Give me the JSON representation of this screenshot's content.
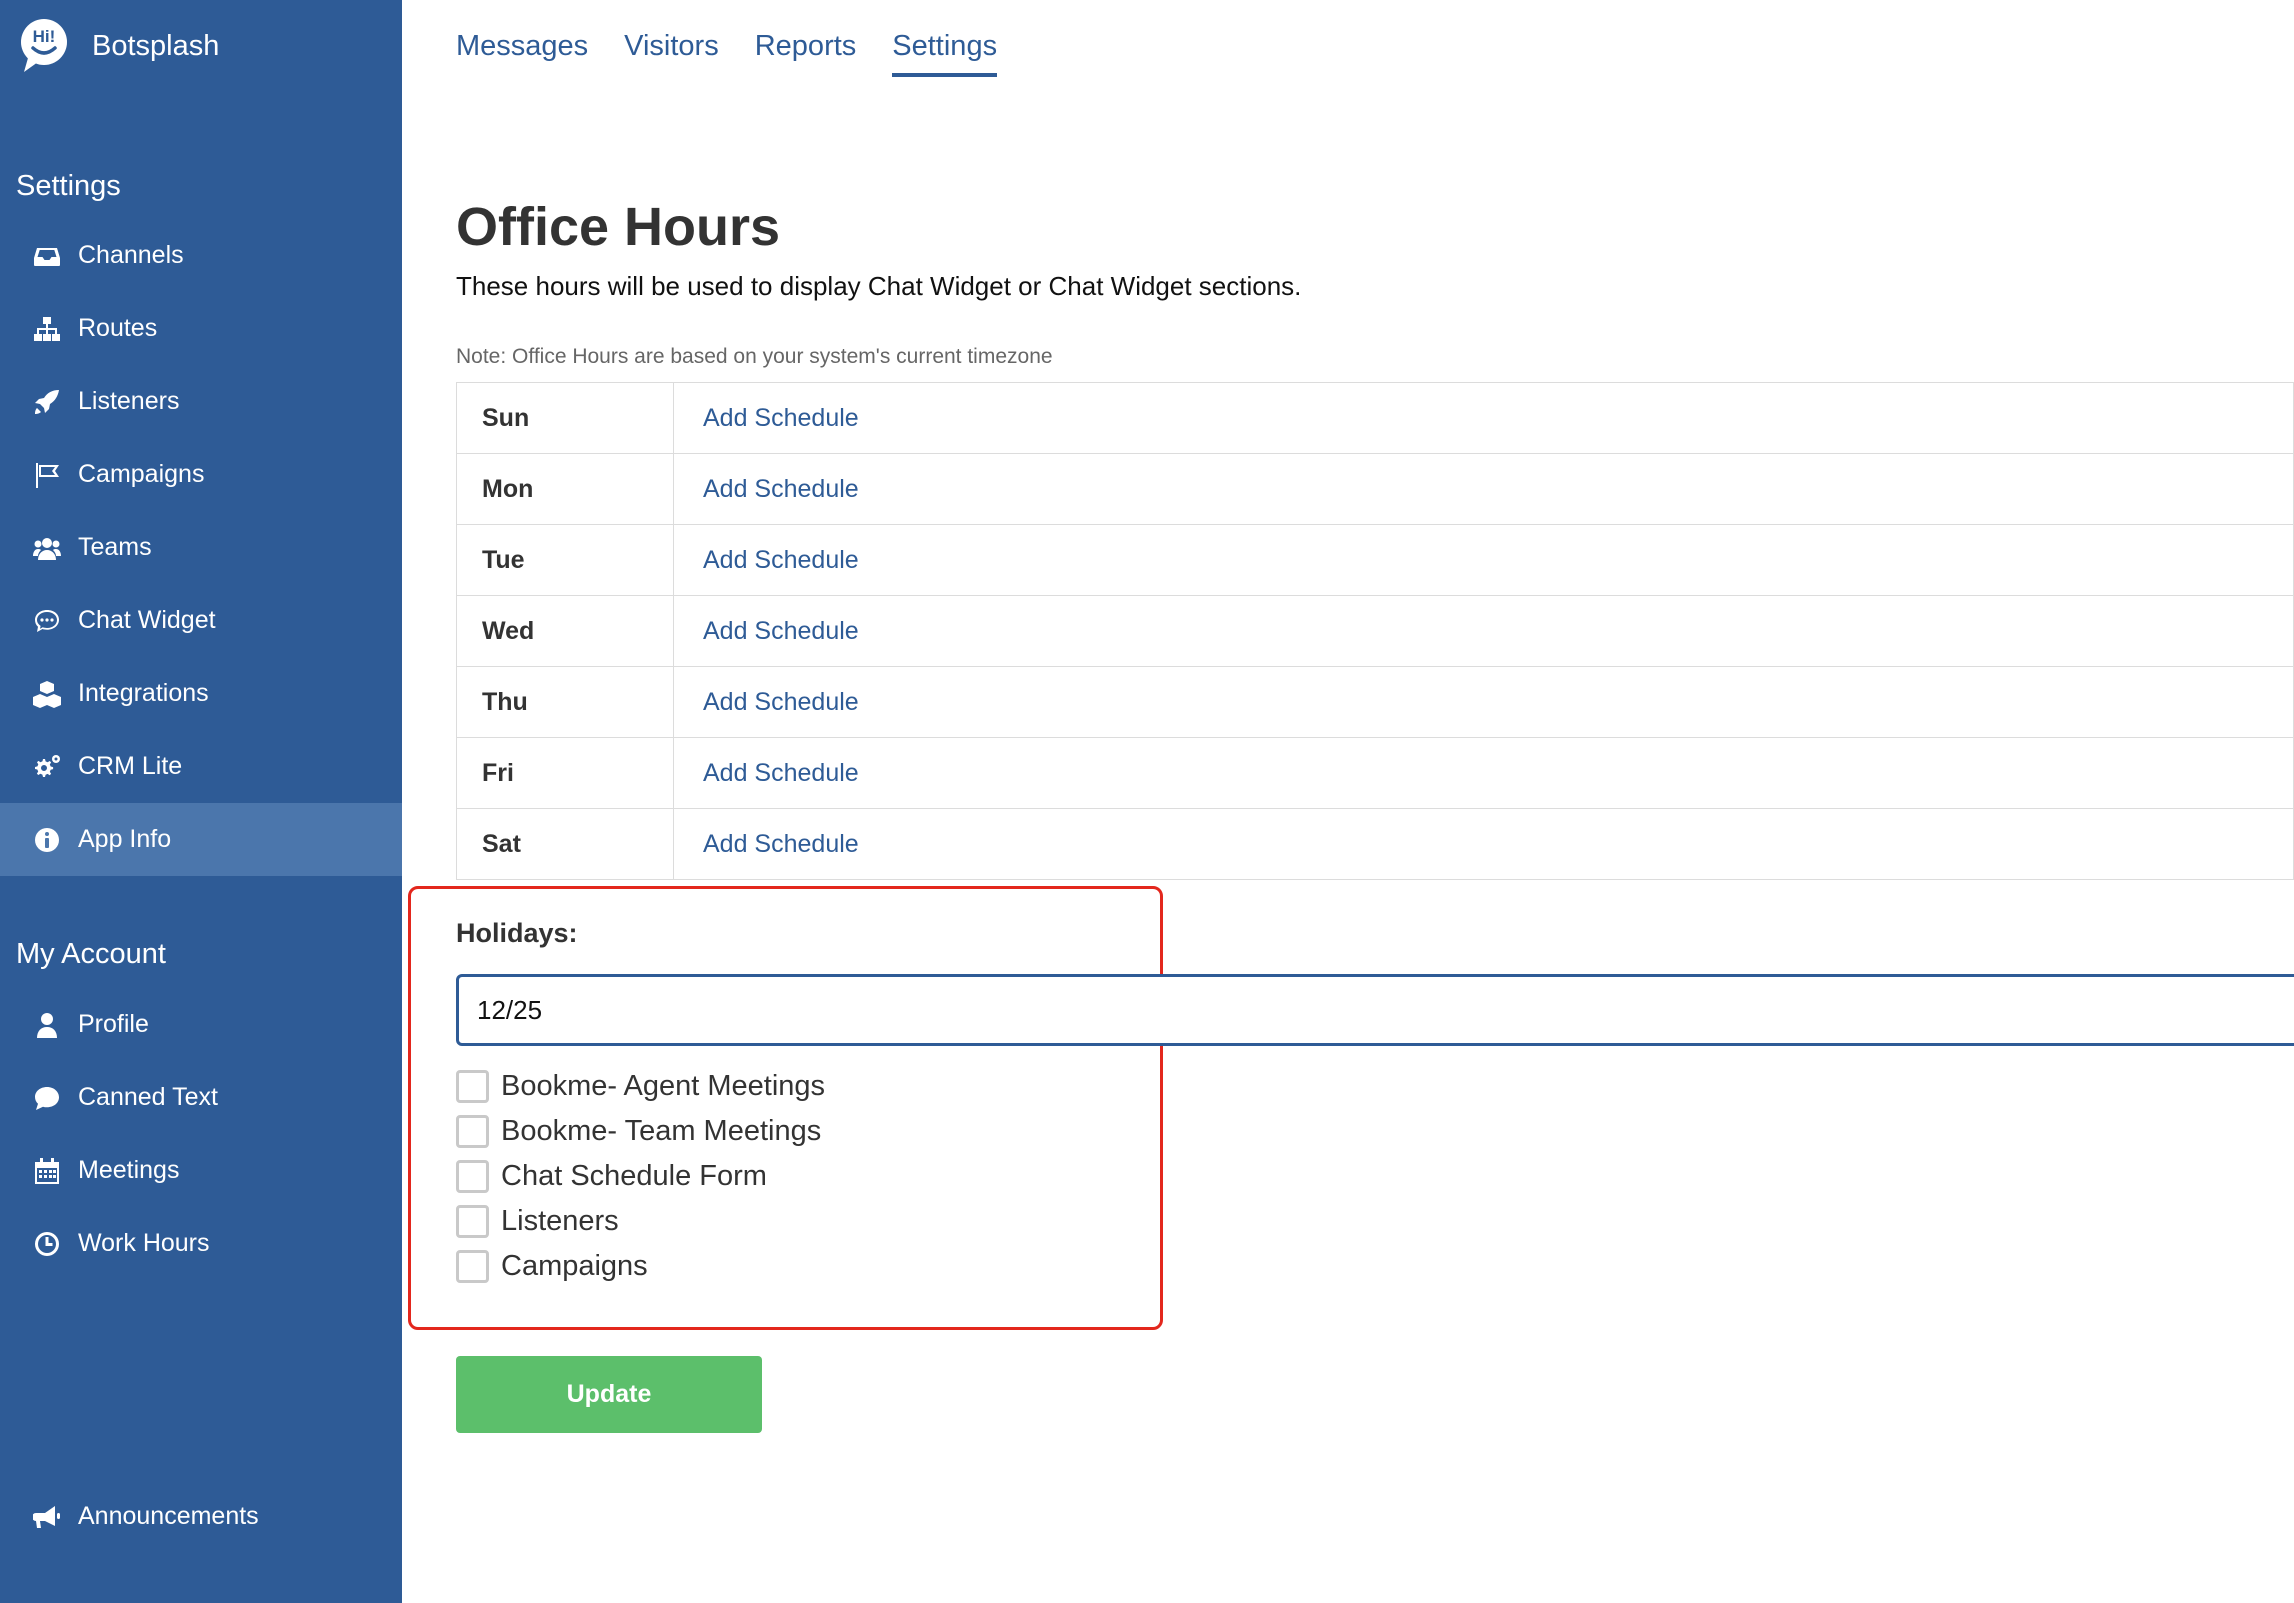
{
  "brand": {
    "name": "Botsplash",
    "logo_text": "Hi!"
  },
  "sidebar": {
    "settings_title": "Settings",
    "settings_items": [
      {
        "label": "Channels",
        "icon": "inbox-icon"
      },
      {
        "label": "Routes",
        "icon": "sitemap-icon"
      },
      {
        "label": "Listeners",
        "icon": "rocket-icon"
      },
      {
        "label": "Campaigns",
        "icon": "flag-icon"
      },
      {
        "label": "Teams",
        "icon": "users-icon"
      },
      {
        "label": "Chat Widget",
        "icon": "chat-bubble-icon"
      },
      {
        "label": "Integrations",
        "icon": "cubes-icon"
      },
      {
        "label": "CRM Lite",
        "icon": "cogs-icon"
      },
      {
        "label": "App Info",
        "icon": "info-circle-icon",
        "active": true
      }
    ],
    "account_title": "My Account",
    "account_items": [
      {
        "label": "Profile",
        "icon": "user-icon"
      },
      {
        "label": "Canned Text",
        "icon": "comment-icon"
      },
      {
        "label": "Meetings",
        "icon": "calendar-icon"
      },
      {
        "label": "Work Hours",
        "icon": "clock-icon"
      }
    ],
    "announcements": {
      "label": "Announcements",
      "icon": "megaphone-icon"
    }
  },
  "topnav": {
    "tabs": [
      {
        "label": "Messages"
      },
      {
        "label": "Visitors"
      },
      {
        "label": "Reports"
      },
      {
        "label": "Settings",
        "active": true
      }
    ]
  },
  "main": {
    "title": "Office Hours",
    "subtitle": "These hours will be used to display Chat Widget or Chat Widget sections.",
    "note": "Note: Office Hours are based on your system's current timezone",
    "schedule": [
      {
        "day": "Sun",
        "action": "Add Schedule"
      },
      {
        "day": "Mon",
        "action": "Add Schedule"
      },
      {
        "day": "Tue",
        "action": "Add Schedule"
      },
      {
        "day": "Wed",
        "action": "Add Schedule"
      },
      {
        "day": "Thu",
        "action": "Add Schedule"
      },
      {
        "day": "Fri",
        "action": "Add Schedule"
      },
      {
        "day": "Sat",
        "action": "Add Schedule"
      }
    ],
    "holidays": {
      "label": "Holidays:",
      "value": "12/25"
    },
    "checkboxes": [
      {
        "label": "Bookme- Agent Meetings",
        "checked": false
      },
      {
        "label": "Bookme- Team Meetings",
        "checked": false
      },
      {
        "label": "Chat Schedule Form",
        "checked": false
      },
      {
        "label": "Listeners",
        "checked": false
      },
      {
        "label": "Campaigns",
        "checked": false
      }
    ],
    "update_label": "Update"
  },
  "colors": {
    "sidebar_bg": "#2e5b96",
    "sidebar_active": "#4b76ac",
    "link": "#2e5b96",
    "update_button": "#5cbf6b",
    "highlight_border": "#e3271d"
  }
}
